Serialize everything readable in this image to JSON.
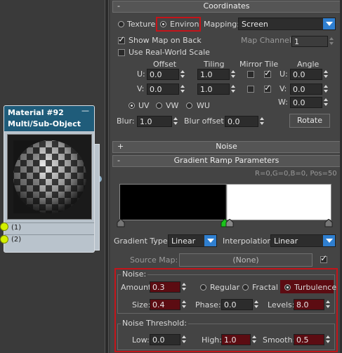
{
  "rollouts": {
    "coordinates": {
      "toggle": "-",
      "title": "Coordinates"
    },
    "noise": {
      "toggle": "+",
      "title": "Noise"
    },
    "gradient_ramp": {
      "toggle": "-",
      "title": "Gradient Ramp Parameters"
    }
  },
  "coordinates": {
    "texture_label": "Texture",
    "environ_label": "Environ",
    "mapping_label": "Mapping:",
    "mapping_value": "Screen",
    "show_map_on_back": "Show Map on Back",
    "map_channel_label": "Map Channel:",
    "map_channel_value": "1",
    "use_real_world_scale": "Use Real-World Scale",
    "offset_header": "Offset",
    "tiling_header": "Tiling",
    "mirror_tile_header": "Mirror Tile",
    "angle_header": "Angle",
    "u_label": "U:",
    "v_label": "V:",
    "w_label": "W:",
    "offset_u": "0.0",
    "offset_v": "0.0",
    "tiling_u": "1.0",
    "tiling_v": "1.0",
    "angle_u": "0.0",
    "angle_v": "0.0",
    "angle_w": "0.0",
    "uv_label": "UV",
    "vw_label": "VW",
    "wu_label": "WU",
    "blur_label": "Blur:",
    "blur_value": "1.0",
    "blur_offset_label": "Blur offset:",
    "blur_offset_value": "0.0",
    "rotate_label": "Rotate"
  },
  "gradient": {
    "readout": "R=0,G=0,B=0, Pos=50",
    "gradient_type_label": "Gradient Type:",
    "gradient_type_value": "Linear",
    "interpolation_label": "Interpolation:",
    "interpolation_value": "Linear",
    "source_map_label": "Source Map:",
    "source_map_value": "(None)"
  },
  "noise": {
    "group_label": "Noise:",
    "amount_label": "Amount:",
    "amount_value": "0.3",
    "regular_label": "Regular",
    "fractal_label": "Fractal",
    "turbulence_label": "Turbulence",
    "size_label": "Size:",
    "size_value": "0.4",
    "phase_label": "Phase:",
    "phase_value": "0.0",
    "levels_label": "Levels:",
    "levels_value": "8.0",
    "threshold_label": "Noise Threshold:",
    "low_label": "Low:",
    "low_value": "0.0",
    "high_label": "High:",
    "high_value": "1.0",
    "smooth_label": "Smooth:",
    "smooth_value": "0.5"
  },
  "node": {
    "title": "Material #92",
    "subtitle": "Multi/Sub-Object",
    "collapse": "—",
    "slot1": "(1)",
    "slot2": "(2)"
  },
  "colors": {
    "highlight_red": "#c4141a",
    "accent_blue": "#2f7fd0",
    "port_yellow": "#d4f000",
    "node_header": "#1f5c7a"
  }
}
